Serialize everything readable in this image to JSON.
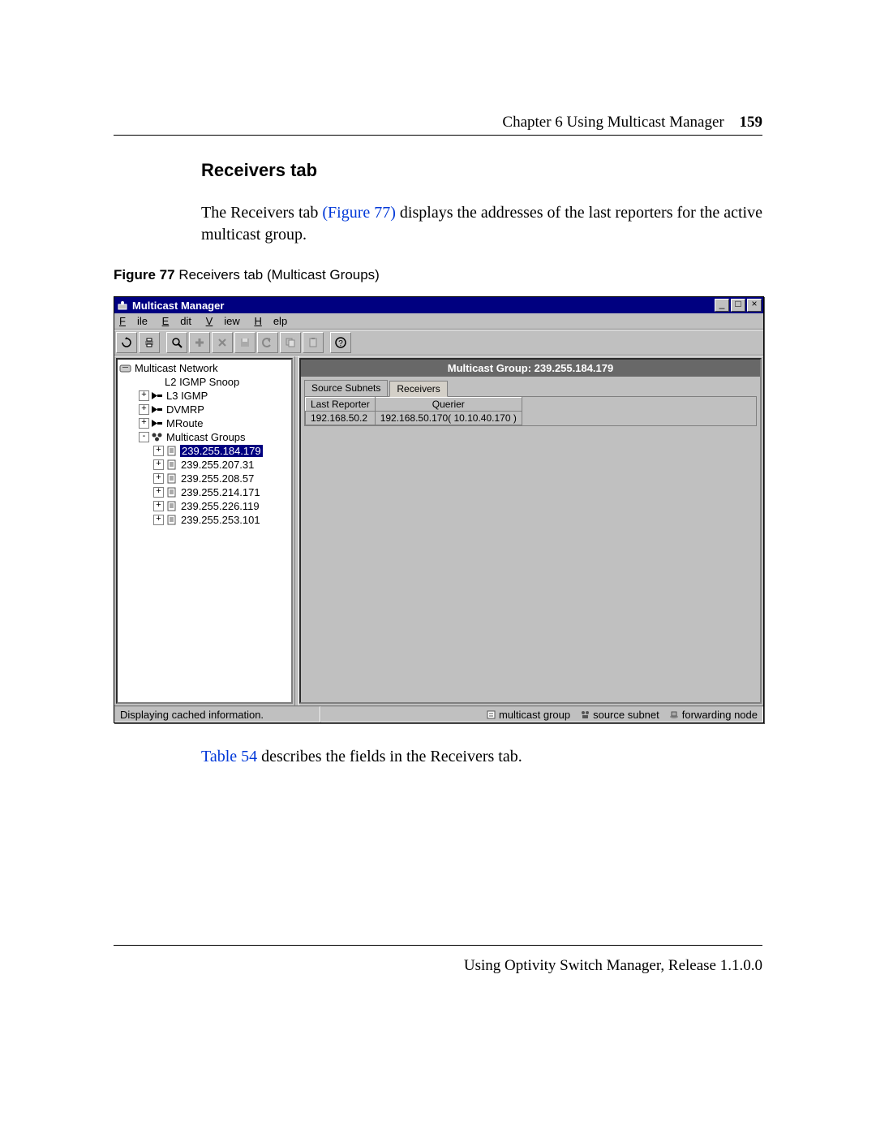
{
  "header": {
    "chapter": "Chapter 6  Using Multicast Manager",
    "page": "159"
  },
  "section": {
    "heading": "Receivers tab"
  },
  "para1": {
    "pre": "The Receivers tab ",
    "link": "(Figure 77)",
    "post": " displays the addresses of the last reporters for the active multicast group."
  },
  "figcap": {
    "num": "Figure 77",
    "text": "   Receivers tab (Multicast Groups)"
  },
  "win": {
    "title": "Multicast Manager",
    "menu": {
      "file": "File",
      "edit": "Edit",
      "view": "View",
      "help": "Help"
    },
    "tree": {
      "root": "Multicast Network",
      "items": [
        {
          "label": "L2 IGMP Snoop",
          "depth": 1,
          "expander": null,
          "icon": "line"
        },
        {
          "label": "L3 IGMP",
          "depth": 1,
          "expander": "+",
          "icon": "arrow"
        },
        {
          "label": "DVMRP",
          "depth": 1,
          "expander": "+",
          "icon": "arrow"
        },
        {
          "label": "MRoute",
          "depth": 1,
          "expander": "+",
          "icon": "arrow"
        },
        {
          "label": "Multicast Groups",
          "depth": 1,
          "expander": "-",
          "icon": "groups"
        },
        {
          "label": "239.255.184.179",
          "depth": 2,
          "expander": "+",
          "icon": "page",
          "selected": true
        },
        {
          "label": "239.255.207.31",
          "depth": 2,
          "expander": "+",
          "icon": "page"
        },
        {
          "label": "239.255.208.57",
          "depth": 2,
          "expander": "+",
          "icon": "page"
        },
        {
          "label": "239.255.214.171",
          "depth": 2,
          "expander": "+",
          "icon": "page"
        },
        {
          "label": "239.255.226.119",
          "depth": 2,
          "expander": "+",
          "icon": "page"
        },
        {
          "label": "239.255.253.101",
          "depth": 2,
          "expander": "+",
          "icon": "page"
        }
      ]
    },
    "content": {
      "title": "Multicast Group: 239.255.184.179",
      "tabs": {
        "inactive": "Source Subnets",
        "active": "Receivers"
      },
      "cols": {
        "c1": "Last Reporter",
        "c2": "Querier"
      },
      "row": {
        "c1": "192.168.50.2",
        "c2": "192.168.50.170( 10.10.40.170 )"
      }
    },
    "status": {
      "text": "Displaying cached information.",
      "legend": {
        "a": "multicast group",
        "b": "source subnet",
        "c": "forwarding node"
      }
    }
  },
  "para2": {
    "link": "Table 54",
    "post": " describes the fields in the Receivers tab."
  },
  "footer": {
    "text": "Using Optivity Switch Manager, Release 1.1.0.0"
  }
}
